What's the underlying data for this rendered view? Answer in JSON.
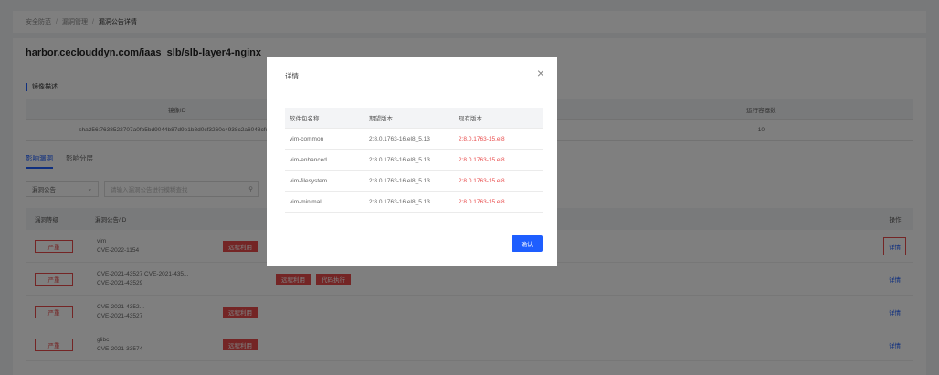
{
  "breadcrumb": {
    "items": [
      "安全防范",
      "漏洞管理",
      "漏洞公告详情"
    ]
  },
  "image": {
    "title": "harbor.ceclouddyn.com/iaas_slb/slb-layer4-nginx",
    "section_label": "镜像描述",
    "table": {
      "headers": [
        "镜像ID",
        "",
        "运行容器数"
      ],
      "values": [
        "sha256:7638522707a0fb5bd9044b87d9e1b8d0cf3260c4938c2a6048cfc47",
        "",
        "10"
      ]
    }
  },
  "tabs": [
    {
      "label": "影响漏洞"
    },
    {
      "label": "影响分层"
    }
  ],
  "filters": {
    "select_value": "漏洞公告",
    "search_placeholder": "请输入漏洞公告进行模糊查找"
  },
  "list": {
    "headers": {
      "level": "漏洞等级",
      "id": "漏洞公告/ID",
      "op": "操作"
    },
    "rows": [
      {
        "severity": "严重",
        "name": "vim",
        "cves": "CVE-2022-1154",
        "tags": [
          "远程利用"
        ],
        "action": "详情"
      },
      {
        "severity": "严重",
        "name": "CVE-2021-43527 CVE-2021-435...",
        "cves": "CVE-2021-43529",
        "tags": [
          "远程利用",
          "代码执行"
        ],
        "action": "详情"
      },
      {
        "severity": "严重",
        "name": "CVE-2021-4352...",
        "cves": "CVE-2021-43527",
        "tags": [
          "远程利用"
        ],
        "action": "详情"
      },
      {
        "severity": "严重",
        "name": "glibc",
        "cves": "CVE-2021-33574",
        "tags": [
          "远程利用"
        ],
        "action": "详情"
      }
    ]
  },
  "modal": {
    "title": "详情",
    "headers": [
      "软件包名称",
      "期望版本",
      "现有版本"
    ],
    "rows": [
      [
        "vim-common",
        "2:8.0.1763-16.el8_5.13",
        "2:8.0.1763-15.el8"
      ],
      [
        "vim-enhanced",
        "2:8.0.1763-16.el8_5.13",
        "2:8.0.1763-15.el8"
      ],
      [
        "vim-filesystem",
        "2:8.0.1763-16.el8_5.13",
        "2:8.0.1763-15.el8"
      ],
      [
        "vim-minimal",
        "2:8.0.1763-16.el8_5.13",
        "2:8.0.1763-15.el8"
      ]
    ],
    "confirm_label": "确认"
  },
  "colors": {
    "accent": "#1e5eff",
    "danger": "#e94b4b"
  },
  "icons": {
    "close": "close-icon",
    "dropdown": "chevron-down-icon",
    "search": "search-icon"
  }
}
